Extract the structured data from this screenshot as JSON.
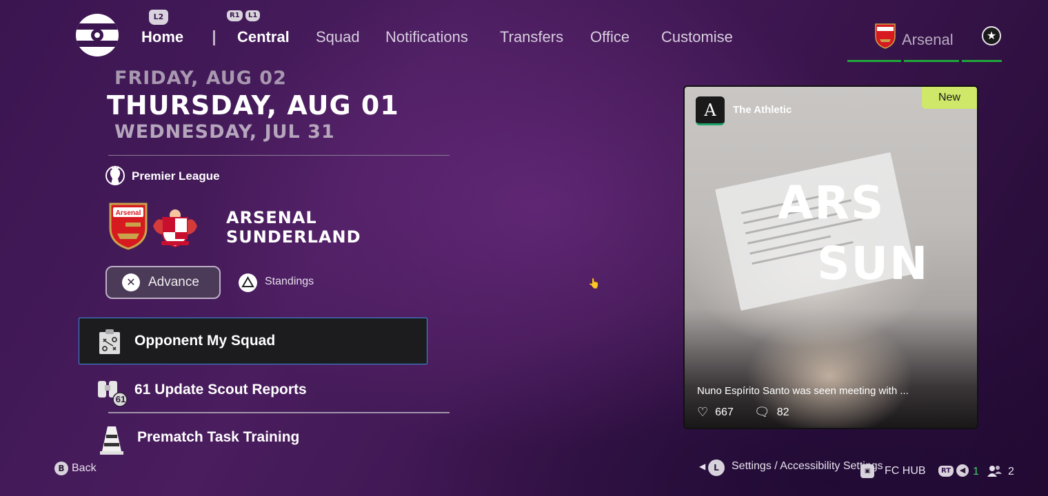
{
  "nav": {
    "l2_hint": "L2",
    "r1_hint": "R1",
    "l1_hint": "L1",
    "home": "Home",
    "tabs": [
      "Central",
      "Squad",
      "Notifications",
      "Transfers",
      "Office",
      "Customise"
    ],
    "active_tab": "Central",
    "club_name": "Arsenal"
  },
  "dates": {
    "previous": "FRIDAY, AUG 02",
    "current": "THURSDAY, AUG 01",
    "next": "WEDNESDAY, JUL 31"
  },
  "match": {
    "league": "Premier League",
    "home_team": "ARSENAL",
    "away_team": "SUNDERLAND",
    "home_crest_text": "Arsenal",
    "advance_label": "Advance",
    "standings_label": "Standings"
  },
  "menu": {
    "items": [
      {
        "label": "Opponent My Squad",
        "icon": "tactics-board-icon"
      },
      {
        "label": "61 Update Scout Reports",
        "icon": "binoculars-icon",
        "badge": "61"
      },
      {
        "label": "Prematch Task Training",
        "icon": "training-cone-icon"
      }
    ]
  },
  "news_card": {
    "source": "The Athletic",
    "badge": "New",
    "headline_line1": "ARS",
    "headline_line2": "SUN",
    "caption": "Nuno Espírito Santo was seen meeting with ...",
    "likes": "667",
    "comments": "82"
  },
  "bottom": {
    "back_button_glyph": "B",
    "back_label": "Back",
    "settings_button_glyph": "L",
    "settings_label": "Settings / Accessibility Settings",
    "fc_hub_label": "FC HUB",
    "rt_hint": "RT",
    "notifications_count": "1",
    "players_count": "2"
  },
  "colors": {
    "accent_green": "#1fa83a",
    "focus_blue": "#3b8fe0",
    "new_badge": "#cfe86a",
    "background": "#3a1550"
  }
}
